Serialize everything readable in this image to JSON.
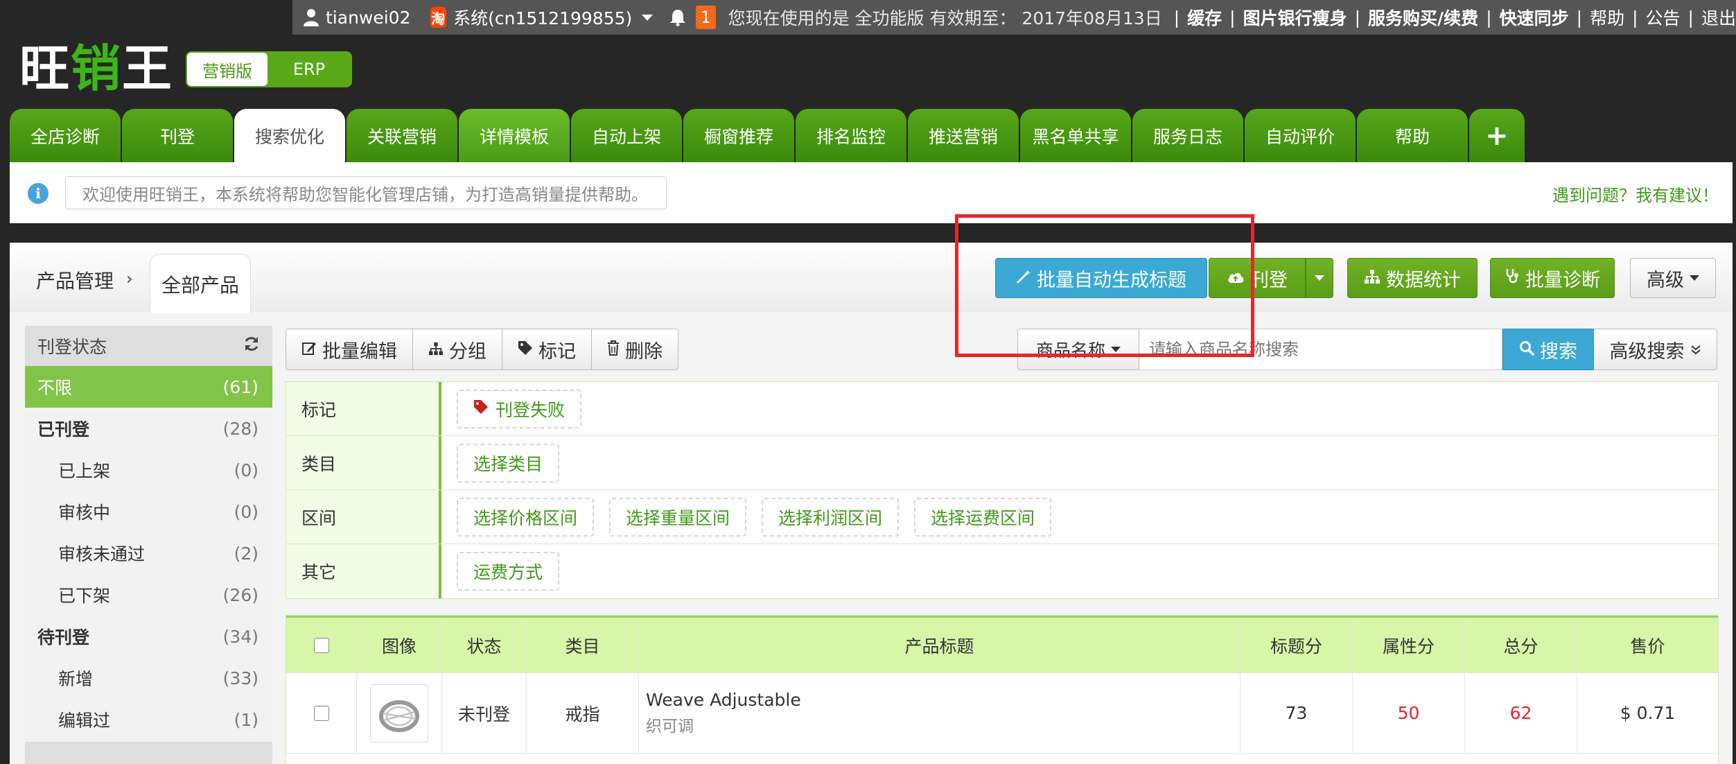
{
  "topbar": {
    "username": "tianwei02",
    "system_label": "系统(cn1512199855)",
    "notification_count": "1",
    "notice_text": "您现在使用的是 全功能版 有效期至： 2017年08月13日",
    "links": [
      "缓存",
      "图片银行瘦身",
      "服务购买/续费",
      "快速同步",
      "帮助",
      "公告",
      "退出"
    ]
  },
  "logo": {
    "part1": "旺",
    "part2": "销",
    "part3": "王"
  },
  "version_switch": {
    "marketing": "营销版",
    "erp": "ERP"
  },
  "tabs": [
    "全店诊断",
    "刊登",
    "搜索优化",
    "关联营销",
    "详情模板",
    "自动上架",
    "橱窗推荐",
    "排名监控",
    "推送营销",
    "黑名单共享",
    "服务日志",
    "自动评价",
    "帮助",
    "+"
  ],
  "active_tab": "搜索优化",
  "info": {
    "welcome": "欢迎使用旺销王，本系统将帮助您智能化管理店铺，为打造高销量提供帮助。",
    "feedback": "遇到问题？我有建议！"
  },
  "breadcrumb": {
    "root": "产品管理",
    "arrow": "›",
    "current": "全部产品"
  },
  "actions": {
    "auto_title": "批量自动生成标题",
    "publish": "刊登",
    "stats": "数据统计",
    "diagnose": "批量诊断",
    "advanced": "高级"
  },
  "sidebar": {
    "header": "刊登状态",
    "items": [
      {
        "label": "不限",
        "count": "(61)"
      },
      {
        "label": "已刊登",
        "count": "(28)"
      },
      {
        "label": "已上架",
        "count": "(0)"
      },
      {
        "label": "审核中",
        "count": "(0)"
      },
      {
        "label": "审核未通过",
        "count": "(2)"
      },
      {
        "label": "已下架",
        "count": "(26)"
      },
      {
        "label": "待刊登",
        "count": "(34)"
      },
      {
        "label": "新增",
        "count": "(33)"
      },
      {
        "label": "编辑过",
        "count": "(1)"
      }
    ]
  },
  "toolbar": {
    "batch_edit": "批量编辑",
    "group": "分组",
    "mark": "标记",
    "delete": "删除"
  },
  "search": {
    "field": "商品名称",
    "placeholder": "请输入商品名称搜索",
    "button": "搜索",
    "advanced": "高级搜索"
  },
  "filters": [
    {
      "label": "标记",
      "options": [
        "刊登失败"
      ]
    },
    {
      "label": "类目",
      "options": [
        "选择类目"
      ]
    },
    {
      "label": "区间",
      "options": [
        "选择价格区间",
        "选择重量区间",
        "选择利润区间",
        "选择运费区间"
      ]
    },
    {
      "label": "其它",
      "options": [
        "运费方式"
      ]
    }
  ],
  "table": {
    "headers": [
      "",
      "图像",
      "状态",
      "类目",
      "产品标题",
      "标题分",
      "属性分",
      "总分",
      "售价"
    ],
    "rows": [
      {
        "status": "未刊登",
        "category": "戒指",
        "title_en": "Weave Adjustable",
        "title_zh": "织可调",
        "title_score": "73",
        "attr_score": "50",
        "total": "62",
        "price": "$ 0.71"
      }
    ]
  },
  "colors": {
    "brand_green": "#4b9a13",
    "accent_blue": "#3ba9d3",
    "highlight_red": "#e8262b"
  }
}
